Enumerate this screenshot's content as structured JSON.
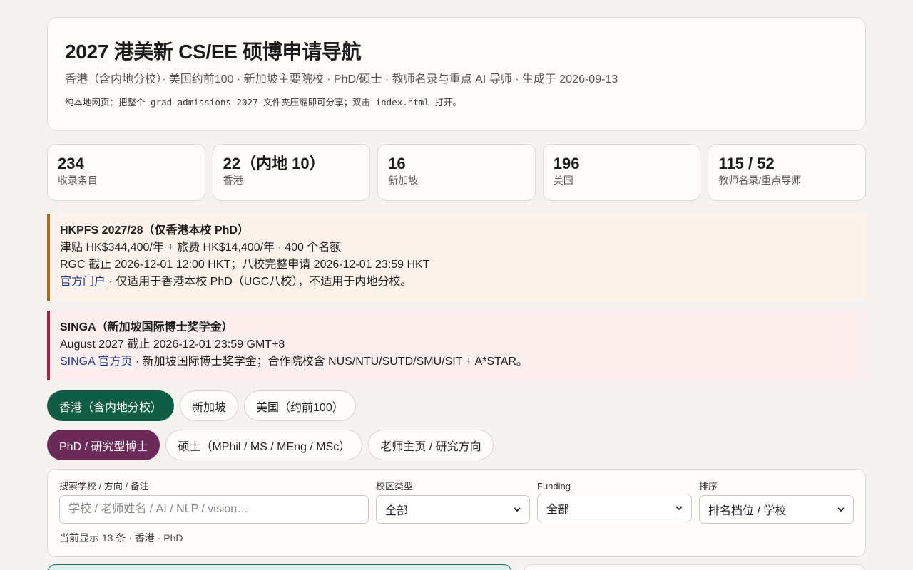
{
  "header": {
    "title": "2027 港美新 CS/EE 硕博申请导航",
    "subtitle": "香港（含内地分校）· 美国约前100 · 新加坡主要院校 · PhD/硕士 · 教师名录与重点 AI 导师 · 生成于 2026-09-13",
    "note": "纯本地网页：把整个 grad-admissions-2027 文件夹压缩即可分享；双击 index.html 打开。"
  },
  "stats": [
    {
      "value": "234",
      "label": "收录条目"
    },
    {
      "value": "22（内地 10）",
      "label": "香港"
    },
    {
      "value": "16",
      "label": "新加坡"
    },
    {
      "value": "196",
      "label": "美国"
    },
    {
      "value": "115 / 52",
      "label": "教师名录/重点导师"
    }
  ],
  "notices": [
    {
      "title": "HKPFS 2027/28（仅香港本校 PhD）",
      "line1": "津贴 HK$344,400/年 + 旅费 HK$14,400/年 · 400 个名额",
      "line2": "RGC 截止 2026-12-01 12:00 HKT；八校完整申请 2026-12-01 23:59 HKT",
      "link": "官方门户",
      "tail": " · 仅适用于香港本校 PhD（UGC八校），不适用于内地分校。"
    },
    {
      "title": "SINGA（新加坡国际博士奖学金）",
      "line1": "August 2027 截止 2026-12-01 23:59 GMT+8",
      "link": "SINGA 官方页",
      "tail": " · 新加坡国际博士奖学金；合作院校含 NUS/NTU/SUTD/SMU/SIT + A*STAR。"
    }
  ],
  "region_tabs": [
    "香港（含内地分校）",
    "新加坡",
    "美国（约前100）"
  ],
  "program_tabs": [
    "PhD / 研究型博士",
    "硕士（MPhil / MS / MEng / MSc）",
    "老师主页 / 研究方向"
  ],
  "filters": {
    "search_label": "搜索学校 / 方向 / 备注",
    "search_placeholder": "学校 / 老师姓名 / AI / NLP / vision…",
    "campus_label": "校区类型",
    "campus_value": "全部",
    "funding_label": "Funding",
    "funding_value": "全部",
    "sort_label": "排序",
    "sort_value": "排名档位 / 学校",
    "count_text": "当前显示 13 条 · 香港 · PhD"
  },
  "colors": {
    "accent_green": "#0f5d45",
    "accent_purple": "#6b2a57",
    "notice_orange": "#b8641a",
    "notice_red": "#9e2440",
    "link_blue": "#1e3a8a"
  }
}
